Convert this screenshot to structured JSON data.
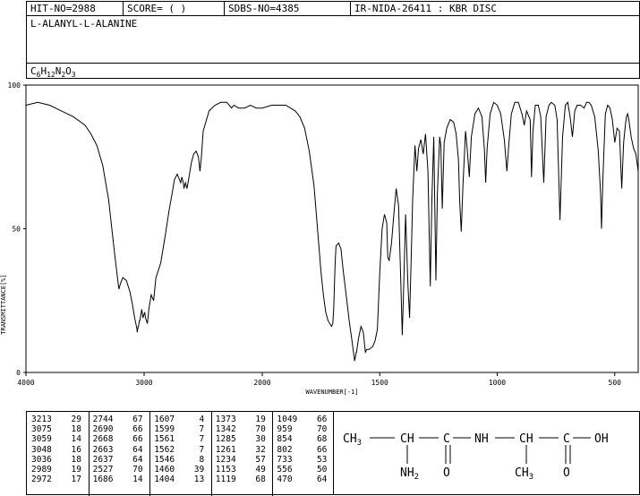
{
  "header": {
    "hit_no": "HIT-NO=2988",
    "score": "SCORE=  (   )",
    "sdbs_no": "SDBS-NO=4385",
    "ir_nida": "IR-NIDA-26411 : KBR DISC",
    "compound_name": "L-ALANYL-L-ALANINE",
    "formula": {
      "parts": [
        {
          "t": "C",
          "sub": "6"
        },
        {
          "t": "H",
          "sub": "12"
        },
        {
          "t": "N",
          "sub": "2"
        },
        {
          "t": "O",
          "sub": "3"
        }
      ]
    }
  },
  "chart_data": {
    "type": "line",
    "title": "",
    "xlabel": "WAVENUMBER[-1]",
    "ylabel": "TRANSMITTANCE[%]",
    "xlim": [
      4000,
      400
    ],
    "ylim": [
      0,
      100
    ],
    "x_ticks": [
      4000,
      3000,
      2000,
      1500,
      1000,
      500
    ],
    "y_ticks": [
      0,
      50,
      100
    ],
    "grid": false,
    "series": [
      {
        "name": "",
        "color": "#000000",
        "points": [
          [
            4000,
            93
          ],
          [
            3900,
            94
          ],
          [
            3800,
            93
          ],
          [
            3700,
            91
          ],
          [
            3600,
            89
          ],
          [
            3500,
            86
          ],
          [
            3450,
            83
          ],
          [
            3400,
            79
          ],
          [
            3350,
            72
          ],
          [
            3300,
            60
          ],
          [
            3260,
            45
          ],
          [
            3240,
            38
          ],
          [
            3220,
            31
          ],
          [
            3213,
            29
          ],
          [
            3200,
            31
          ],
          [
            3180,
            33
          ],
          [
            3150,
            32
          ],
          [
            3120,
            28
          ],
          [
            3100,
            24
          ],
          [
            3080,
            19
          ],
          [
            3075,
            18
          ],
          [
            3060,
            15
          ],
          [
            3059,
            14
          ],
          [
            3050,
            16
          ],
          [
            3048,
            16
          ],
          [
            3040,
            18
          ],
          [
            3036,
            18
          ],
          [
            3020,
            22
          ],
          [
            3010,
            19
          ],
          [
            2995,
            21
          ],
          [
            2989,
            19
          ],
          [
            2980,
            18
          ],
          [
            2972,
            17
          ],
          [
            2960,
            22
          ],
          [
            2940,
            27
          ],
          [
            2920,
            25
          ],
          [
            2900,
            33
          ],
          [
            2860,
            38
          ],
          [
            2820,
            48
          ],
          [
            2790,
            56
          ],
          [
            2760,
            63
          ],
          [
            2744,
            67
          ],
          [
            2720,
            69
          ],
          [
            2700,
            67
          ],
          [
            2690,
            66
          ],
          [
            2680,
            68
          ],
          [
            2668,
            66
          ],
          [
            2663,
            64
          ],
          [
            2650,
            66
          ],
          [
            2637,
            64
          ],
          [
            2620,
            68
          ],
          [
            2600,
            73
          ],
          [
            2580,
            76
          ],
          [
            2560,
            77
          ],
          [
            2540,
            75
          ],
          [
            2527,
            70
          ],
          [
            2515,
            75
          ],
          [
            2500,
            84
          ],
          [
            2450,
            91
          ],
          [
            2400,
            93
          ],
          [
            2350,
            94
          ],
          [
            2300,
            94
          ],
          [
            2260,
            92
          ],
          [
            2240,
            93
          ],
          [
            2200,
            92
          ],
          [
            2150,
            92
          ],
          [
            2100,
            93
          ],
          [
            2050,
            92
          ],
          [
            2000,
            92
          ],
          [
            1960,
            93
          ],
          [
            1930,
            93
          ],
          [
            1900,
            93
          ],
          [
            1880,
            92
          ],
          [
            1860,
            91
          ],
          [
            1840,
            89
          ],
          [
            1820,
            85
          ],
          [
            1800,
            77
          ],
          [
            1780,
            65
          ],
          [
            1760,
            45
          ],
          [
            1750,
            35
          ],
          [
            1740,
            27
          ],
          [
            1730,
            21
          ],
          [
            1720,
            18
          ],
          [
            1705,
            16
          ],
          [
            1700,
            17
          ],
          [
            1696,
            22
          ],
          [
            1690,
            38
          ],
          [
            1686,
            44
          ],
          [
            1675,
            45
          ],
          [
            1665,
            43
          ],
          [
            1655,
            35
          ],
          [
            1640,
            25
          ],
          [
            1630,
            18
          ],
          [
            1620,
            12
          ],
          [
            1607,
            4
          ],
          [
            1600,
            7
          ],
          [
            1599,
            7
          ],
          [
            1590,
            12
          ],
          [
            1580,
            16
          ],
          [
            1570,
            14
          ],
          [
            1561,
            7
          ],
          [
            1555,
            8
          ],
          [
            1546,
            8
          ],
          [
            1530,
            9
          ],
          [
            1520,
            11
          ],
          [
            1510,
            15
          ],
          [
            1500,
            35
          ],
          [
            1490,
            50
          ],
          [
            1480,
            55
          ],
          [
            1470,
            52
          ],
          [
            1466,
            40
          ],
          [
            1460,
            39
          ],
          [
            1450,
            45
          ],
          [
            1440,
            55
          ],
          [
            1430,
            64
          ],
          [
            1420,
            58
          ],
          [
            1410,
            30
          ],
          [
            1404,
            13
          ],
          [
            1398,
            30
          ],
          [
            1390,
            55
          ],
          [
            1380,
            30
          ],
          [
            1373,
            19
          ],
          [
            1366,
            40
          ],
          [
            1360,
            60
          ],
          [
            1350,
            79
          ],
          [
            1342,
            70
          ],
          [
            1335,
            78
          ],
          [
            1325,
            81
          ],
          [
            1315,
            76
          ],
          [
            1305,
            83
          ],
          [
            1295,
            70
          ],
          [
            1285,
            30
          ],
          [
            1278,
            60
          ],
          [
            1270,
            82
          ],
          [
            1261,
            32
          ],
          [
            1255,
            62
          ],
          [
            1245,
            82
          ],
          [
            1240,
            79
          ],
          [
            1234,
            57
          ],
          [
            1226,
            80
          ],
          [
            1215,
            85
          ],
          [
            1200,
            88
          ],
          [
            1185,
            87
          ],
          [
            1175,
            83
          ],
          [
            1165,
            74
          ],
          [
            1160,
            60
          ],
          [
            1153,
            49
          ],
          [
            1146,
            65
          ],
          [
            1135,
            84
          ],
          [
            1128,
            78
          ],
          [
            1119,
            68
          ],
          [
            1110,
            82
          ],
          [
            1095,
            90
          ],
          [
            1080,
            92
          ],
          [
            1065,
            89
          ],
          [
            1055,
            78
          ],
          [
            1049,
            66
          ],
          [
            1043,
            78
          ],
          [
            1030,
            90
          ],
          [
            1015,
            94
          ],
          [
            1000,
            93
          ],
          [
            985,
            90
          ],
          [
            970,
            81
          ],
          [
            959,
            70
          ],
          [
            950,
            80
          ],
          [
            940,
            90
          ],
          [
            925,
            94
          ],
          [
            910,
            94
          ],
          [
            895,
            90
          ],
          [
            885,
            86
          ],
          [
            875,
            91
          ],
          [
            860,
            88
          ],
          [
            854,
            68
          ],
          [
            848,
            84
          ],
          [
            838,
            93
          ],
          [
            825,
            93
          ],
          [
            815,
            89
          ],
          [
            802,
            66
          ],
          [
            792,
            89
          ],
          [
            780,
            93
          ],
          [
            770,
            94
          ],
          [
            755,
            93
          ],
          [
            745,
            88
          ],
          [
            733,
            53
          ],
          [
            722,
            82
          ],
          [
            710,
            93
          ],
          [
            700,
            94
          ],
          [
            690,
            89
          ],
          [
            680,
            82
          ],
          [
            670,
            91
          ],
          [
            660,
            93
          ],
          [
            645,
            93
          ],
          [
            630,
            92
          ],
          [
            620,
            94
          ],
          [
            610,
            94
          ],
          [
            600,
            93
          ],
          [
            585,
            89
          ],
          [
            570,
            77
          ],
          [
            560,
            62
          ],
          [
            556,
            50
          ],
          [
            550,
            68
          ],
          [
            540,
            90
          ],
          [
            530,
            93
          ],
          [
            520,
            92
          ],
          [
            510,
            88
          ],
          [
            500,
            80
          ],
          [
            490,
            85
          ],
          [
            480,
            84
          ],
          [
            470,
            64
          ],
          [
            462,
            80
          ],
          [
            455,
            86
          ],
          [
            450,
            89
          ],
          [
            445,
            90
          ],
          [
            440,
            88
          ],
          [
            430,
            82
          ],
          [
            420,
            78
          ],
          [
            410,
            76
          ],
          [
            400,
            70
          ]
        ]
      }
    ]
  },
  "peaks": {
    "columns": [
      [
        [
          "3213",
          "29"
        ],
        [
          "3075",
          "18"
        ],
        [
          "3059",
          "14"
        ],
        [
          "3048",
          "16"
        ],
        [
          "3036",
          "18"
        ],
        [
          "2989",
          "19"
        ],
        [
          "2972",
          "17"
        ]
      ],
      [
        [
          "2744",
          "67"
        ],
        [
          "2690",
          "66"
        ],
        [
          "2668",
          "66"
        ],
        [
          "2663",
          "64"
        ],
        [
          "2637",
          "64"
        ],
        [
          "2527",
          "70"
        ],
        [
          "1686",
          "14"
        ]
      ],
      [
        [
          "1607",
          "4"
        ],
        [
          "1599",
          "7"
        ],
        [
          "1561",
          "7"
        ],
        [
          "1562",
          "7"
        ],
        [
          "1546",
          "8"
        ],
        [
          "1460",
          "39"
        ],
        [
          "1404",
          "13"
        ]
      ],
      [
        [
          "1373",
          "19"
        ],
        [
          "1342",
          "70"
        ],
        [
          "1285",
          "30"
        ],
        [
          "1261",
          "32"
        ],
        [
          "1234",
          "57"
        ],
        [
          "1153",
          "49"
        ],
        [
          "1119",
          "68"
        ]
      ],
      [
        [
          "1049",
          "66"
        ],
        [
          "959",
          "70"
        ],
        [
          "854",
          "68"
        ],
        [
          "802",
          "66"
        ],
        [
          "733",
          "53"
        ],
        [
          "556",
          "50"
        ],
        [
          "470",
          "64"
        ]
      ]
    ]
  },
  "structure": {
    "ch3_left": "CH3",
    "ch": "CH",
    "c1": "C",
    "nh": "NH",
    "ch2": "CH",
    "c2": "C",
    "oh": "OH",
    "nh2": "NH2",
    "o1": "O",
    "ch3_bottom": "CH3",
    "o2": "O"
  }
}
